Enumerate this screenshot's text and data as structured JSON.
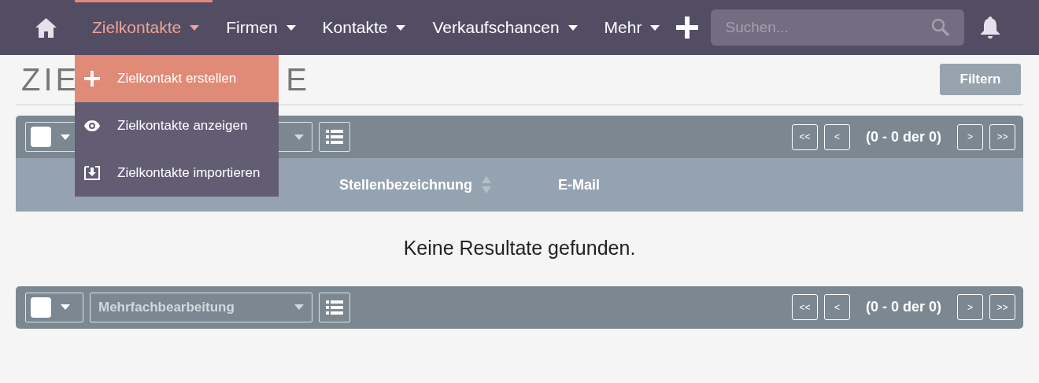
{
  "navbar": {
    "items": [
      {
        "label": "Zielkontakte",
        "selected": true
      },
      {
        "label": "Firmen",
        "selected": false
      },
      {
        "label": "Kontakte",
        "selected": false
      },
      {
        "label": "Verkaufschancen",
        "selected": false
      },
      {
        "label": "Mehr",
        "selected": false
      }
    ],
    "search": {
      "placeholder": "Suchen..."
    }
  },
  "dropdown": {
    "items": [
      {
        "label": "Zielkontakt erstellen",
        "kind": "create",
        "selected": true
      },
      {
        "label": "Zielkontakte anzeigen",
        "kind": "view",
        "selected": false
      },
      {
        "label": "Zielkontakte importieren",
        "kind": "import",
        "selected": false
      }
    ]
  },
  "page": {
    "title_parts": [
      "ZIE",
      "E"
    ],
    "filter_button": "Filtern"
  },
  "list": {
    "top_toolbar": {
      "checked": false,
      "pager": [
        "<<",
        "<",
        "(0 - 0 der 0)",
        ">",
        ">>"
      ]
    },
    "columns": [
      {
        "label": "Stellenbezeichnung",
        "sortable": true
      },
      {
        "label": "E-Mail",
        "sortable": false
      }
    ],
    "empty_message": "Keine Resultate gefunden.",
    "bottom_toolbar": {
      "checked": false,
      "bulk_action": "Mehrfachbearbeitung",
      "pager": [
        "<<",
        "<",
        "(0 - 0 der 0)",
        ">",
        ">>"
      ]
    }
  }
}
